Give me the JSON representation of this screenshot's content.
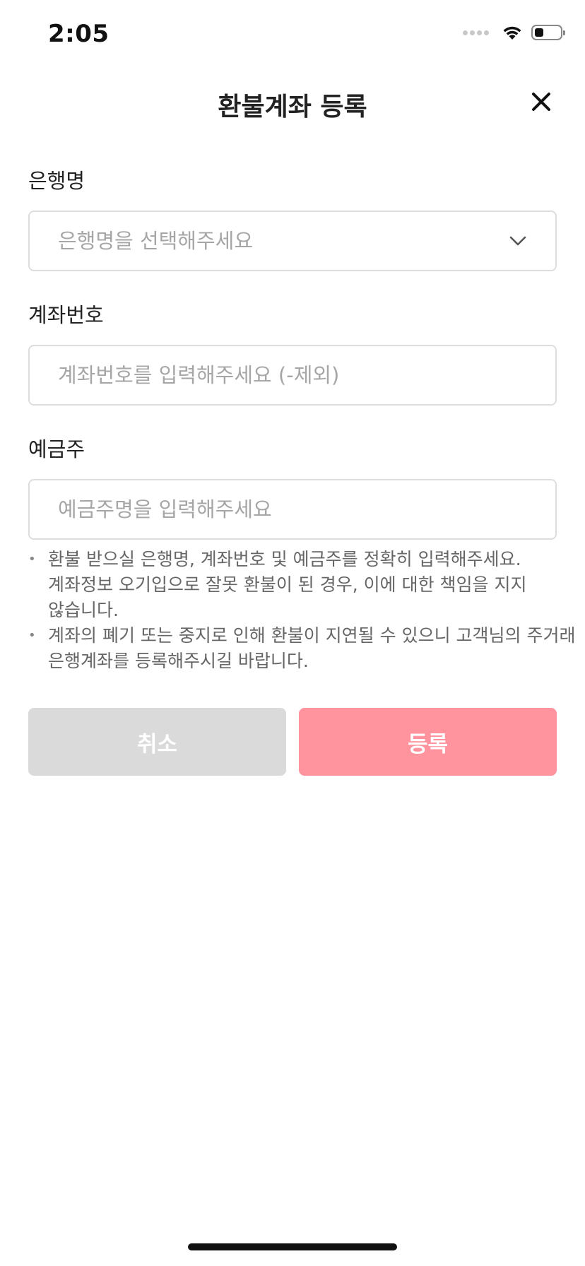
{
  "status_bar": {
    "time": "2:05",
    "battery_level": 0.35,
    "icons": [
      "cellular-signal-icon",
      "wifi-icon",
      "battery-icon"
    ]
  },
  "header": {
    "title": "환불계좌 등록",
    "close_icon": "close-icon"
  },
  "form": {
    "bank": {
      "label": "은행명",
      "placeholder": "은행명을 선택해주세요",
      "icon": "chevron-down-icon"
    },
    "account_number": {
      "label": "계좌번호",
      "placeholder": "계좌번호를 입력해주세요 (-제외)"
    },
    "account_holder": {
      "label": "예금주",
      "placeholder": "예금주명을 입력해주세요"
    }
  },
  "notice": {
    "items": [
      {
        "lines": [
          "환불 받으실 은행명, 계좌번호 및 예금주를 정확히 입력해주세요.",
          "계좌정보 오기입으로 잘못 환불이 된 경우, 이에 대한 책임을 지지",
          "않습니다."
        ]
      },
      {
        "lines": [
          "계좌의 폐기 또는 중지로 인해 환불이 지연될 수 있으니 고객님의 주거래",
          "은행계좌를 등록해주시길 바랍니다."
        ]
      }
    ]
  },
  "buttons": {
    "cancel_label": "취소",
    "submit_label": "등록"
  },
  "colors": {
    "cancel_bg": "#dadada",
    "submit_bg": "#ff939e",
    "placeholder": "#a6a6a6",
    "border": "#dddddd"
  }
}
